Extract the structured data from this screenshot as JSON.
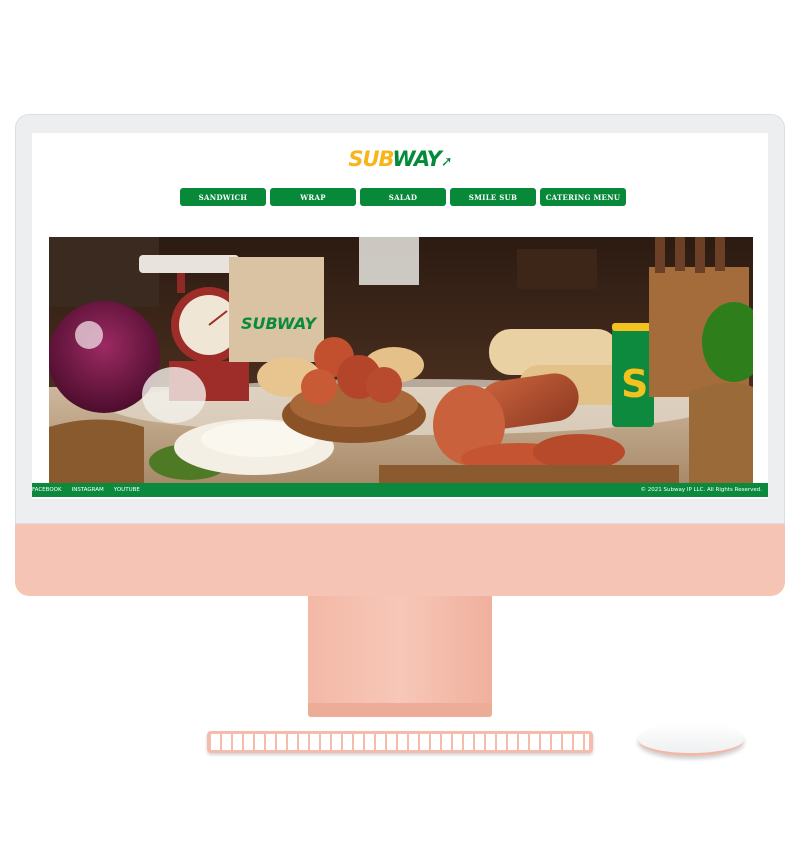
{
  "header": {
    "logo_sub": "SUB",
    "logo_way": "WAY"
  },
  "nav": {
    "items": [
      {
        "label": "SANDWICH"
      },
      {
        "label": "WRAP"
      },
      {
        "label": "SALAD"
      },
      {
        "label": "SMILE SUB"
      },
      {
        "label": "CATERING MENU"
      }
    ]
  },
  "hero": {
    "bag_text": "SUBWAY",
    "cup_letter": "S"
  },
  "footer": {
    "links": [
      {
        "label": "FACEBOOK"
      },
      {
        "label": "INSTAGRAM"
      },
      {
        "label": "YOUTUBE"
      }
    ],
    "copyright": "© 2021 Subway IP LLC. All Rights Reserved."
  },
  "colors": {
    "brand_green": "#08893a",
    "brand_yellow": "#f8b51b",
    "device_pink": "#f6c4b4"
  }
}
